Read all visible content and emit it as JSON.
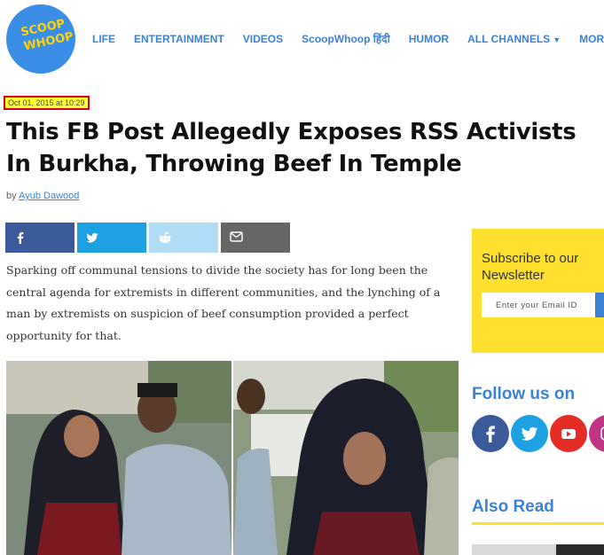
{
  "brand": {
    "logo_text": "SCOOP WHOOP",
    "logo_color": "#3b8ee6",
    "logo_text_color": "#ffd400"
  },
  "nav": {
    "items": [
      {
        "label": "LIFE"
      },
      {
        "label": "ENTERTAINMENT"
      },
      {
        "label": "VIDEOS"
      },
      {
        "label": "ScoopWhoop हिंदी"
      },
      {
        "label": "HUMOR"
      },
      {
        "label": "ALL CHANNELS",
        "icon": "chevron-down-icon"
      },
      {
        "label": "MORE",
        "icon": "chevron-down-icon"
      }
    ],
    "color": "#3b82d6"
  },
  "article": {
    "date": "Oct 01, 2015 at 10:29",
    "title": "This FB Post Allegedly Exposes RSS Activists In Burkha, Throwing Beef In Temple",
    "byline_prefix": "by",
    "author": "Ayub Dawood",
    "body": "Sparking off communal tensions to divide the society has for long been the central agenda for extremists in different communities, and the lynching of a man by extremists on suspicion of beef consumption provided a perfect opportunity for that."
  },
  "share_buttons": [
    {
      "icon": "facebook-icon",
      "color": "#3b5a99"
    },
    {
      "icon": "twitter-icon",
      "color": "#1da1e2"
    },
    {
      "icon": "reddit-icon",
      "color": "#b0dcf5"
    },
    {
      "icon": "email-icon",
      "color": "#666666"
    }
  ],
  "sidebar": {
    "newsletter": {
      "title": "Subscribe to our Newsletter",
      "placeholder": "Enter your Email ID",
      "bg_color": "#ffe02e"
    },
    "follow": {
      "title": "Follow us on",
      "icons": [
        "facebook-icon",
        "twitter-icon",
        "youtube-icon",
        "instagram-icon"
      ]
    },
    "also_read": {
      "title": "Also Read"
    }
  }
}
